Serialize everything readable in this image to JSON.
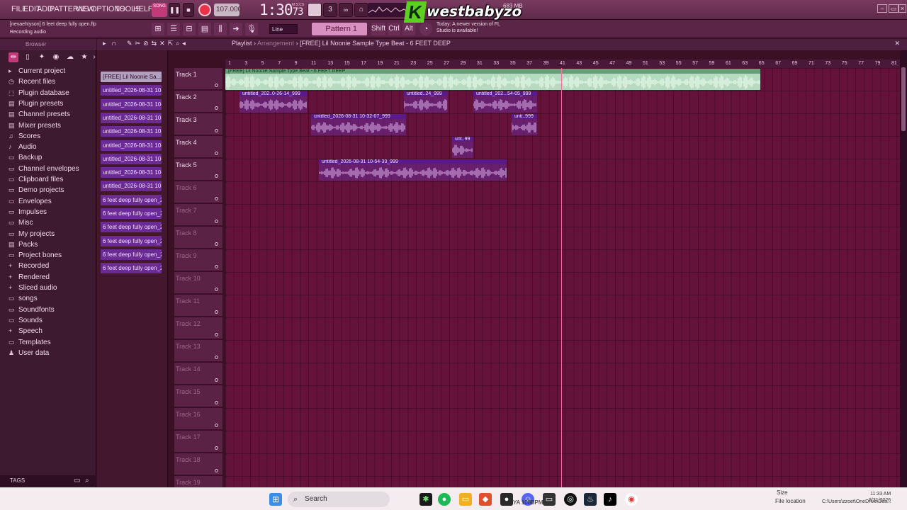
{
  "menu": [
    "FILE",
    "EDIT",
    "ADD",
    "PATTERNS",
    "VIEW",
    "OPTIONS",
    "TOOLS",
    "HELP"
  ],
  "transport": {
    "tempo": "107.000",
    "time": "1:30",
    "time_ms": "73",
    "time_unit": "M:S:CS",
    "song_toggle": "SONG"
  },
  "logo": {
    "k": "K",
    "text": "westbabyzo"
  },
  "memory": "683 MB",
  "hint": {
    "file": "[nevaehtyson] 6 feet deep fully open.flp",
    "recording": "Recording audio"
  },
  "snap": "Line",
  "pattern": "Pattern 1",
  "keys": [
    "Shift",
    "Ctrl",
    "Alt"
  ],
  "news": "Today: A newer version of FL Studio is available!",
  "browser": {
    "title": "Browser",
    "items": [
      {
        "label": "Current project",
        "icon": "▸"
      },
      {
        "label": "Recent files",
        "icon": "◷"
      },
      {
        "label": "Plugin database",
        "icon": "⬚"
      },
      {
        "label": "Plugin presets",
        "icon": "▤"
      },
      {
        "label": "Channel presets",
        "icon": "▤"
      },
      {
        "label": "Mixer presets",
        "icon": "▤"
      },
      {
        "label": "Scores",
        "icon": "♫"
      },
      {
        "label": "Audio",
        "icon": "♪"
      },
      {
        "label": "Backup",
        "icon": "▭"
      },
      {
        "label": "Channel envelopes",
        "icon": "▭"
      },
      {
        "label": "Clipboard files",
        "icon": "▭"
      },
      {
        "label": "Demo projects",
        "icon": "▭"
      },
      {
        "label": "Envelopes",
        "icon": "▭"
      },
      {
        "label": "Impulses",
        "icon": "▭"
      },
      {
        "label": "Misc",
        "icon": "▭"
      },
      {
        "label": "My projects",
        "icon": "▭"
      },
      {
        "label": "Packs",
        "icon": "▤"
      },
      {
        "label": "Project bones",
        "icon": "▭"
      },
      {
        "label": "Recorded",
        "icon": "+"
      },
      {
        "label": "Rendered",
        "icon": "+"
      },
      {
        "label": "Sliced audio",
        "icon": "+"
      },
      {
        "label": "songs",
        "icon": "▭"
      },
      {
        "label": "Soundfonts",
        "icon": "▭"
      },
      {
        "label": "Sounds",
        "icon": "▭"
      },
      {
        "label": "Speech",
        "icon": "+"
      },
      {
        "label": "Templates",
        "icon": "▭"
      },
      {
        "label": "User data",
        "icon": "♟"
      }
    ],
    "tags": "TAGS"
  },
  "playlist": {
    "title": "Playlist",
    "view": "Arrangement",
    "song": "[FREE] Lil Noonie Sample Type Beat - 6 FEET DEEP",
    "clip_buttons": [
      "[FREE] Lil Noonie Sa...",
      "untitled_2026-08-31 10-...",
      "untitled_2026-08-31 10-...",
      "untitled_2026-08-31 10-...",
      "untitled_2026-08-31 10-...",
      "untitled_2026-08-31 10-...",
      "untitled_2026-08-31 10-...",
      "untitled_2026-08-31 10-...",
      "untitled_2026-08-31 10-...",
      "6 feet deep fully open_2...",
      "6 feet deep fully open_2...",
      "6 feet deep fully open_2...",
      "6 feet deep fully open_2...",
      "6 feet deep fully open_2...",
      "6 feet deep fully open_2..."
    ],
    "tracks": [
      "Track 1",
      "Track 2",
      "Track 3",
      "Track 4",
      "Track 5",
      "Track 6",
      "Track 7",
      "Track 8",
      "Track 9",
      "Track 10",
      "Track 11",
      "Track 12",
      "Track 13",
      "Track 14",
      "Track 15",
      "Track 16",
      "Track 17",
      "Track 18",
      "Track 19"
    ],
    "ruler": [
      "1",
      "3",
      "5",
      "7",
      "9",
      "11",
      "13",
      "15",
      "17",
      "19",
      "21",
      "23",
      "25",
      "27",
      "29",
      "31",
      "33",
      "35",
      "37",
      "39",
      "41",
      "43",
      "45",
      "47",
      "49",
      "51",
      "53",
      "55",
      "57",
      "59",
      "61",
      "63",
      "65",
      "67",
      "69",
      "71",
      "73",
      "75",
      "77",
      "79",
      "81"
    ],
    "clips": [
      {
        "label": "[FREE] Lil Noonie Sample Type Beat - 6 FEET DEEP",
        "kind": "main"
      },
      {
        "label": "untitled_202..0-26-14_999",
        "kind": "rec"
      },
      {
        "label": "untitled..24_999",
        "kind": "rec"
      },
      {
        "label": "untitled_202...54-05_999",
        "kind": "rec"
      },
      {
        "label": "untitled_2026-08-31 10-32-07_999",
        "kind": "rec"
      },
      {
        "label": "unti..999",
        "kind": "rec"
      },
      {
        "label": "unt..99",
        "kind": "rec"
      },
      {
        "label": "untitled_2026-08-31 10-54-33_999",
        "kind": "rec"
      }
    ]
  },
  "taskbar": {
    "search": "Search",
    "time": "11:33 AM",
    "date": "8/31/2026",
    "file_location": "File location",
    "path": "C:\\Users\\zzoet\\OneDrive\\Des...",
    "size": "Size",
    "bpm_text": "YA 108BPM"
  },
  "colors": {
    "accent": "#c23a7a",
    "clip_main": "#b5dcc0",
    "clip_rec": "#6b2a96",
    "grid": "#65123b",
    "playhead": "#ff6aa8"
  }
}
